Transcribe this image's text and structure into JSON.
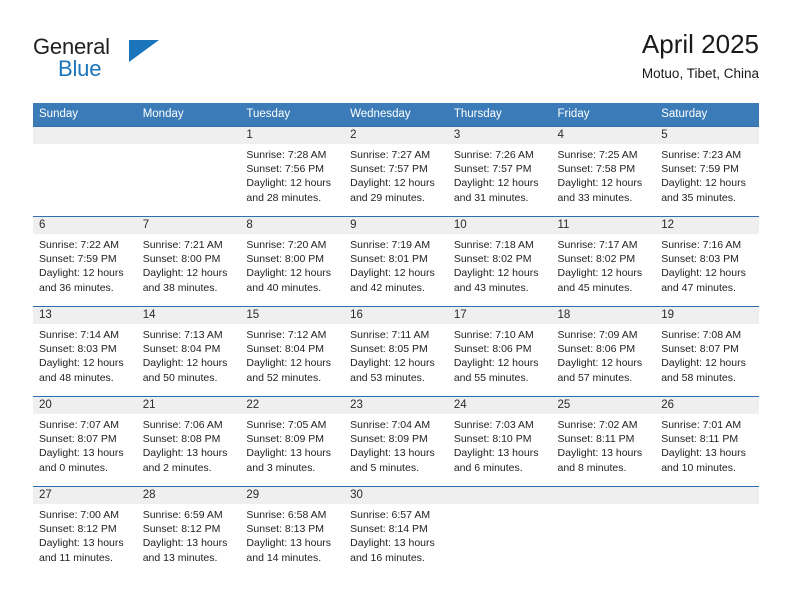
{
  "brand": {
    "name_top": "General",
    "name_bottom": "Blue",
    "accent_color": "#1b75bb",
    "triangle_icon": "brand-triangle-icon"
  },
  "header": {
    "title": "April 2025",
    "subtitle": "Motuo, Tibet, China"
  },
  "colors": {
    "header_row": "#3b7cb8",
    "day_band": "#efefef",
    "week_separator": "#2f6fae",
    "text": "#1a1a1a"
  },
  "weekday_headers": [
    "Sunday",
    "Monday",
    "Tuesday",
    "Wednesday",
    "Thursday",
    "Friday",
    "Saturday"
  ],
  "weeks": [
    [
      {
        "day": "",
        "sunrise": "",
        "sunset": "",
        "daylight_line1": "",
        "daylight_line2": ""
      },
      {
        "day": "",
        "sunrise": "",
        "sunset": "",
        "daylight_line1": "",
        "daylight_line2": ""
      },
      {
        "day": "1",
        "sunrise": "Sunrise: 7:28 AM",
        "sunset": "Sunset: 7:56 PM",
        "daylight_line1": "Daylight: 12 hours",
        "daylight_line2": "and 28 minutes."
      },
      {
        "day": "2",
        "sunrise": "Sunrise: 7:27 AM",
        "sunset": "Sunset: 7:57 PM",
        "daylight_line1": "Daylight: 12 hours",
        "daylight_line2": "and 29 minutes."
      },
      {
        "day": "3",
        "sunrise": "Sunrise: 7:26 AM",
        "sunset": "Sunset: 7:57 PM",
        "daylight_line1": "Daylight: 12 hours",
        "daylight_line2": "and 31 minutes."
      },
      {
        "day": "4",
        "sunrise": "Sunrise: 7:25 AM",
        "sunset": "Sunset: 7:58 PM",
        "daylight_line1": "Daylight: 12 hours",
        "daylight_line2": "and 33 minutes."
      },
      {
        "day": "5",
        "sunrise": "Sunrise: 7:23 AM",
        "sunset": "Sunset: 7:59 PM",
        "daylight_line1": "Daylight: 12 hours",
        "daylight_line2": "and 35 minutes."
      }
    ],
    [
      {
        "day": "6",
        "sunrise": "Sunrise: 7:22 AM",
        "sunset": "Sunset: 7:59 PM",
        "daylight_line1": "Daylight: 12 hours",
        "daylight_line2": "and 36 minutes."
      },
      {
        "day": "7",
        "sunrise": "Sunrise: 7:21 AM",
        "sunset": "Sunset: 8:00 PM",
        "daylight_line1": "Daylight: 12 hours",
        "daylight_line2": "and 38 minutes."
      },
      {
        "day": "8",
        "sunrise": "Sunrise: 7:20 AM",
        "sunset": "Sunset: 8:00 PM",
        "daylight_line1": "Daylight: 12 hours",
        "daylight_line2": "and 40 minutes."
      },
      {
        "day": "9",
        "sunrise": "Sunrise: 7:19 AM",
        "sunset": "Sunset: 8:01 PM",
        "daylight_line1": "Daylight: 12 hours",
        "daylight_line2": "and 42 minutes."
      },
      {
        "day": "10",
        "sunrise": "Sunrise: 7:18 AM",
        "sunset": "Sunset: 8:02 PM",
        "daylight_line1": "Daylight: 12 hours",
        "daylight_line2": "and 43 minutes."
      },
      {
        "day": "11",
        "sunrise": "Sunrise: 7:17 AM",
        "sunset": "Sunset: 8:02 PM",
        "daylight_line1": "Daylight: 12 hours",
        "daylight_line2": "and 45 minutes."
      },
      {
        "day": "12",
        "sunrise": "Sunrise: 7:16 AM",
        "sunset": "Sunset: 8:03 PM",
        "daylight_line1": "Daylight: 12 hours",
        "daylight_line2": "and 47 minutes."
      }
    ],
    [
      {
        "day": "13",
        "sunrise": "Sunrise: 7:14 AM",
        "sunset": "Sunset: 8:03 PM",
        "daylight_line1": "Daylight: 12 hours",
        "daylight_line2": "and 48 minutes."
      },
      {
        "day": "14",
        "sunrise": "Sunrise: 7:13 AM",
        "sunset": "Sunset: 8:04 PM",
        "daylight_line1": "Daylight: 12 hours",
        "daylight_line2": "and 50 minutes."
      },
      {
        "day": "15",
        "sunrise": "Sunrise: 7:12 AM",
        "sunset": "Sunset: 8:04 PM",
        "daylight_line1": "Daylight: 12 hours",
        "daylight_line2": "and 52 minutes."
      },
      {
        "day": "16",
        "sunrise": "Sunrise: 7:11 AM",
        "sunset": "Sunset: 8:05 PM",
        "daylight_line1": "Daylight: 12 hours",
        "daylight_line2": "and 53 minutes."
      },
      {
        "day": "17",
        "sunrise": "Sunrise: 7:10 AM",
        "sunset": "Sunset: 8:06 PM",
        "daylight_line1": "Daylight: 12 hours",
        "daylight_line2": "and 55 minutes."
      },
      {
        "day": "18",
        "sunrise": "Sunrise: 7:09 AM",
        "sunset": "Sunset: 8:06 PM",
        "daylight_line1": "Daylight: 12 hours",
        "daylight_line2": "and 57 minutes."
      },
      {
        "day": "19",
        "sunrise": "Sunrise: 7:08 AM",
        "sunset": "Sunset: 8:07 PM",
        "daylight_line1": "Daylight: 12 hours",
        "daylight_line2": "and 58 minutes."
      }
    ],
    [
      {
        "day": "20",
        "sunrise": "Sunrise: 7:07 AM",
        "sunset": "Sunset: 8:07 PM",
        "daylight_line1": "Daylight: 13 hours",
        "daylight_line2": "and 0 minutes."
      },
      {
        "day": "21",
        "sunrise": "Sunrise: 7:06 AM",
        "sunset": "Sunset: 8:08 PM",
        "daylight_line1": "Daylight: 13 hours",
        "daylight_line2": "and 2 minutes."
      },
      {
        "day": "22",
        "sunrise": "Sunrise: 7:05 AM",
        "sunset": "Sunset: 8:09 PM",
        "daylight_line1": "Daylight: 13 hours",
        "daylight_line2": "and 3 minutes."
      },
      {
        "day": "23",
        "sunrise": "Sunrise: 7:04 AM",
        "sunset": "Sunset: 8:09 PM",
        "daylight_line1": "Daylight: 13 hours",
        "daylight_line2": "and 5 minutes."
      },
      {
        "day": "24",
        "sunrise": "Sunrise: 7:03 AM",
        "sunset": "Sunset: 8:10 PM",
        "daylight_line1": "Daylight: 13 hours",
        "daylight_line2": "and 6 minutes."
      },
      {
        "day": "25",
        "sunrise": "Sunrise: 7:02 AM",
        "sunset": "Sunset: 8:11 PM",
        "daylight_line1": "Daylight: 13 hours",
        "daylight_line2": "and 8 minutes."
      },
      {
        "day": "26",
        "sunrise": "Sunrise: 7:01 AM",
        "sunset": "Sunset: 8:11 PM",
        "daylight_line1": "Daylight: 13 hours",
        "daylight_line2": "and 10 minutes."
      }
    ],
    [
      {
        "day": "27",
        "sunrise": "Sunrise: 7:00 AM",
        "sunset": "Sunset: 8:12 PM",
        "daylight_line1": "Daylight: 13 hours",
        "daylight_line2": "and 11 minutes."
      },
      {
        "day": "28",
        "sunrise": "Sunrise: 6:59 AM",
        "sunset": "Sunset: 8:12 PM",
        "daylight_line1": "Daylight: 13 hours",
        "daylight_line2": "and 13 minutes."
      },
      {
        "day": "29",
        "sunrise": "Sunrise: 6:58 AM",
        "sunset": "Sunset: 8:13 PM",
        "daylight_line1": "Daylight: 13 hours",
        "daylight_line2": "and 14 minutes."
      },
      {
        "day": "30",
        "sunrise": "Sunrise: 6:57 AM",
        "sunset": "Sunset: 8:14 PM",
        "daylight_line1": "Daylight: 13 hours",
        "daylight_line2": "and 16 minutes."
      },
      {
        "day": "",
        "sunrise": "",
        "sunset": "",
        "daylight_line1": "",
        "daylight_line2": ""
      },
      {
        "day": "",
        "sunrise": "",
        "sunset": "",
        "daylight_line1": "",
        "daylight_line2": ""
      },
      {
        "day": "",
        "sunrise": "",
        "sunset": "",
        "daylight_line1": "",
        "daylight_line2": ""
      }
    ]
  ]
}
